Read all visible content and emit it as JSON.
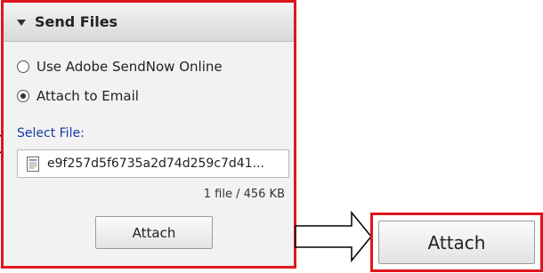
{
  "panel": {
    "title": "Send Files",
    "options": [
      {
        "label": "Use Adobe SendNow Online",
        "selected": false
      },
      {
        "label": "Attach to Email",
        "selected": true
      }
    ],
    "select_file_label": "Select File:",
    "file_name": "e9f257d5f6735a2d74d259c7d41...",
    "file_count": "1 file / 456 KB",
    "attach_label": "Attach"
  },
  "callout": {
    "attach_label": "Attach"
  },
  "colors": {
    "highlight_border": "#e0161c",
    "select_label": "#1a37a8"
  },
  "icons": {
    "collapse": "triangle-down-icon",
    "file": "document-icon"
  }
}
